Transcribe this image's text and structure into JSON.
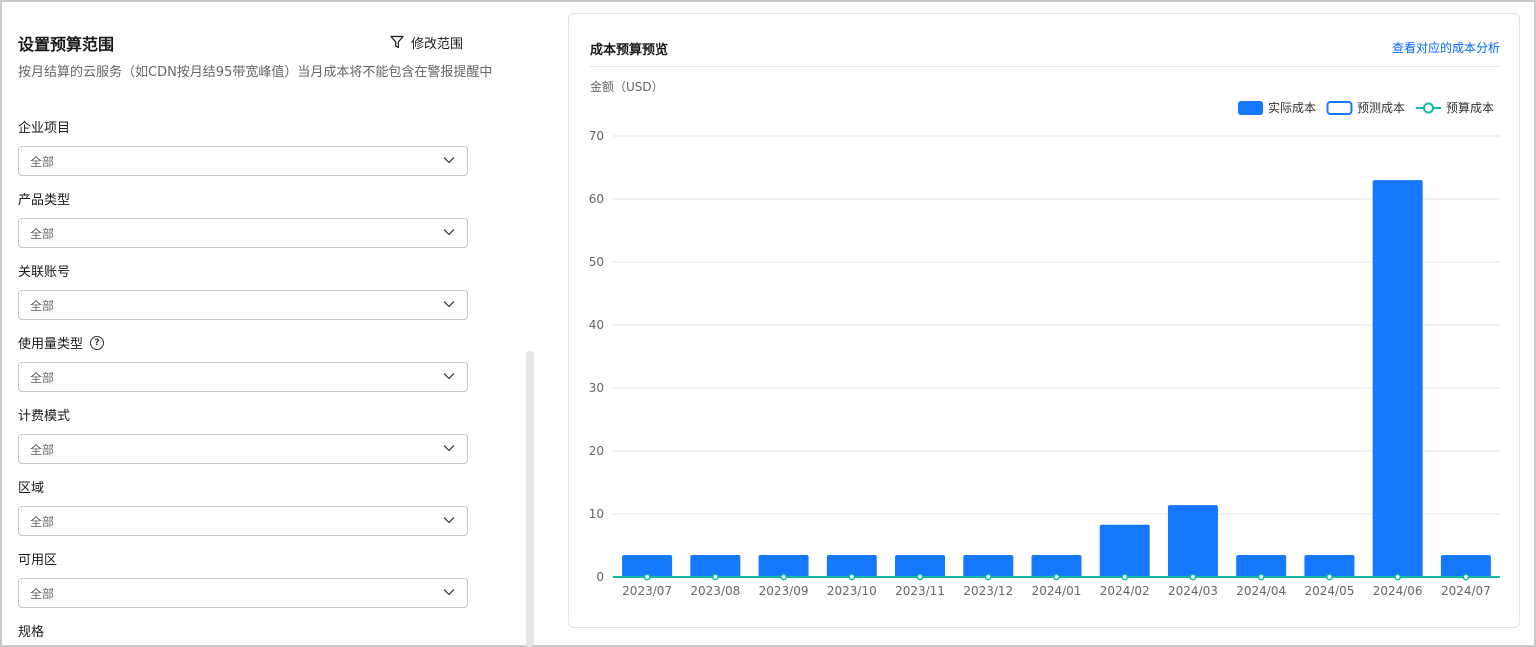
{
  "budget_scope": {
    "title": "设置预算范围",
    "modify_label": "修改范围",
    "description": "按月结算的云服务（如CDN按月结95带宽峰值）当月成本将不能包含在警报提醒中"
  },
  "filters": [
    {
      "label": "企业项目",
      "value": "全部"
    },
    {
      "label": "产品类型",
      "value": "全部"
    },
    {
      "label": "关联账号",
      "value": "全部"
    },
    {
      "label": "使用量类型",
      "value": "全部",
      "help": "?"
    },
    {
      "label": "计费模式",
      "value": "全部"
    },
    {
      "label": "区域",
      "value": "全部"
    },
    {
      "label": "可用区",
      "value": "全部"
    },
    {
      "label": "规格",
      "value": ""
    }
  ],
  "preview": {
    "title": "成本预算预览",
    "link": "查看对应的成本分析"
  },
  "colors": {
    "accent": "#1677ff",
    "budget_line": "#13b8a6",
    "link": "#0066ff"
  },
  "chart_data": {
    "type": "bar",
    "ylabel": "金额（USD）",
    "ylim": [
      0,
      70
    ],
    "yticks": [
      0,
      10,
      20,
      30,
      40,
      50,
      60,
      70
    ],
    "categories": [
      "2023/07",
      "2023/08",
      "2023/09",
      "2023/10",
      "2023/11",
      "2023/12",
      "2024/01",
      "2024/02",
      "2024/03",
      "2024/04",
      "2024/05",
      "2024/06",
      "2024/07"
    ],
    "legend_position": "top-right",
    "grid": true,
    "series": [
      {
        "name": "实际成本",
        "type": "bar",
        "values": [
          3.5,
          3.5,
          3.5,
          3.5,
          3.5,
          3.5,
          3.5,
          8.3,
          11.4,
          3.5,
          3.5,
          63,
          3.5
        ]
      },
      {
        "name": "预测成本",
        "type": "bar-outline",
        "values": []
      },
      {
        "name": "预算成本",
        "type": "line",
        "values": [
          0,
          0,
          0,
          0,
          0,
          0,
          0,
          0,
          0,
          0,
          0,
          0,
          0
        ]
      }
    ]
  }
}
